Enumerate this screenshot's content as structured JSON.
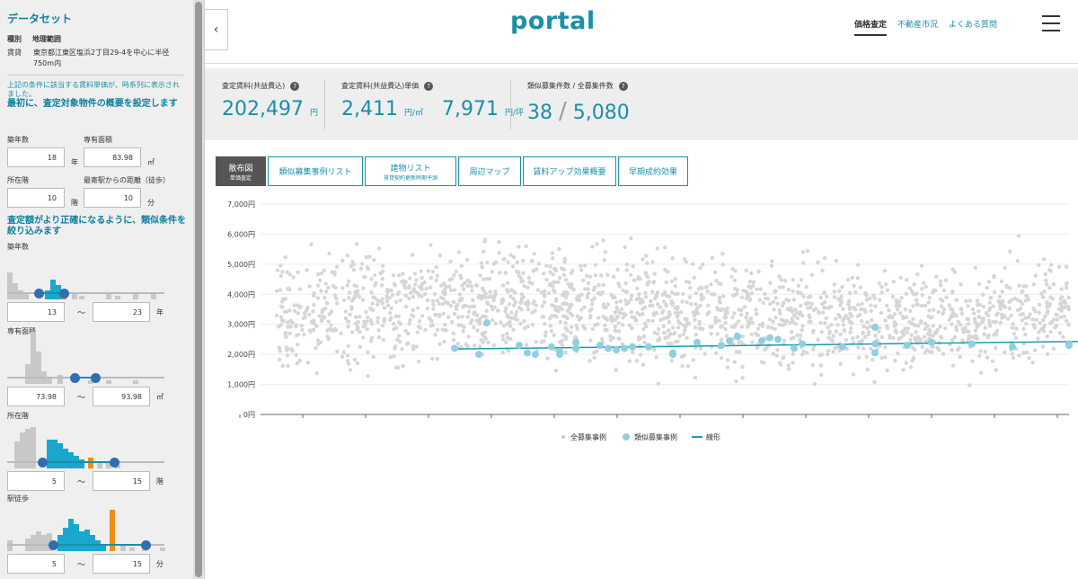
{
  "sidebar": {
    "title": "データセット",
    "kind_header": "種別",
    "range_header": "地理範囲",
    "kind_value": "賃貸",
    "range_value_1": "東京都江東区塩浜2丁目29-4を中心に半径",
    "range_value_2": "750m内",
    "note": "上記の条件に該当する賃料単価が、時系列に表示されました。",
    "heading1": "最初に、査定対象物件の概要を設定します",
    "age_label": "築年数",
    "age_value": "18",
    "age_unit": "年",
    "area_label": "専有面積",
    "area_value": "83.98",
    "area_unit": "㎡",
    "floor_label": "所在階",
    "floor_value": "10",
    "floor_unit": "階",
    "walk_label": "最寄駅からの距離（徒歩）",
    "walk_value": "10",
    "walk_unit": "分",
    "heading2": "査定額がより正確になるように、類似条件を絞り込みます",
    "filters": [
      {
        "label": "築年数",
        "min": "13",
        "max": "23",
        "unit": "年",
        "sel_from": 0.2,
        "sel_to": 0.36
      },
      {
        "label": "専有面積",
        "min": "73.98",
        "max": "93.98",
        "unit": "㎡",
        "sel_from": 0.43,
        "sel_to": 0.56
      },
      {
        "label": "所在階",
        "min": "5",
        "max": "15",
        "unit": "階",
        "sel_from": 0.22,
        "sel_to": 0.68
      },
      {
        "label": "駅徒歩",
        "min": "5",
        "max": "15",
        "unit": "分",
        "sel_from": 0.29,
        "sel_to": 0.88
      }
    ],
    "tilde": "〜"
  },
  "header": {
    "logo": "portal",
    "nav": [
      "価格査定",
      "不動産市況",
      "よくある質問"
    ],
    "collapse_icon": "chevron-left-icon",
    "menu_icon": "hamburger-icon"
  },
  "stats": {
    "rent_label": "査定賃料(共益費込)",
    "rent_value": "202,497",
    "rent_unit": "円",
    "unit_label": "査定賃料(共益費込)単価",
    "unit_value1": "2,411",
    "unit_unit1": "円/㎡",
    "unit_value2": "7,971",
    "unit_unit2": "円/坪",
    "count_label": "類似募集件数 / 全募集件数",
    "count_similar": "38",
    "count_sep": "/",
    "count_total": "5,080"
  },
  "tabs": [
    {
      "label": "散布図",
      "sub": "単価査定",
      "active": true
    },
    {
      "label": "類似募集事例リスト",
      "sub": ""
    },
    {
      "label": "建物リスト",
      "sub": "賃貸契約更新時期予測"
    },
    {
      "label": "周辺マップ",
      "sub": ""
    },
    {
      "label": "賃料アップ効果概要",
      "sub": ""
    },
    {
      "label": "早期成約効果",
      "sub": ""
    }
  ],
  "chart_data": {
    "type": "scatter",
    "ylim": [
      0,
      7000
    ],
    "yticks": [
      "0円",
      "1,000円",
      "2,000円",
      "3,000円",
      "4,000円",
      "5,000円",
      "6,000円",
      "7,000円"
    ],
    "legend": [
      "全募集事例",
      "類似募集事例",
      "線形"
    ],
    "colors": {
      "all": "#d6d6d6",
      "similar": "#8fd0e0",
      "trend": "#1a9bb5"
    },
    "trend": {
      "y_start": 2180,
      "y_end": 2430
    },
    "all_series_summary": {
      "count": 5080,
      "typical_range": [
        1700,
        5300
      ]
    },
    "similar_points": [
      [
        0.24,
        2200
      ],
      [
        0.27,
        2000
      ],
      [
        0.28,
        3050
      ],
      [
        0.32,
        2300
      ],
      [
        0.33,
        2050
      ],
      [
        0.34,
        2000
      ],
      [
        0.36,
        2250
      ],
      [
        0.37,
        2100
      ],
      [
        0.37,
        2000
      ],
      [
        0.39,
        2400
      ],
      [
        0.39,
        2200
      ],
      [
        0.42,
        2300
      ],
      [
        0.43,
        2200
      ],
      [
        0.44,
        2150
      ],
      [
        0.45,
        2200
      ],
      [
        0.46,
        2250
      ],
      [
        0.48,
        2250
      ],
      [
        0.51,
        2050
      ],
      [
        0.51,
        2000
      ],
      [
        0.54,
        2400
      ],
      [
        0.57,
        2300
      ],
      [
        0.58,
        2450
      ],
      [
        0.59,
        2600
      ],
      [
        0.62,
        2450
      ],
      [
        0.63,
        2550
      ],
      [
        0.64,
        2500
      ],
      [
        0.66,
        2200
      ],
      [
        0.67,
        2350
      ],
      [
        0.72,
        2250
      ],
      [
        0.76,
        2900
      ],
      [
        0.76,
        2350
      ],
      [
        0.76,
        2050
      ],
      [
        0.8,
        2300
      ],
      [
        0.83,
        2400
      ],
      [
        0.88,
        2350
      ],
      [
        0.93,
        2250
      ],
      [
        1.01,
        2350
      ],
      [
        1.02,
        2300
      ]
    ]
  }
}
